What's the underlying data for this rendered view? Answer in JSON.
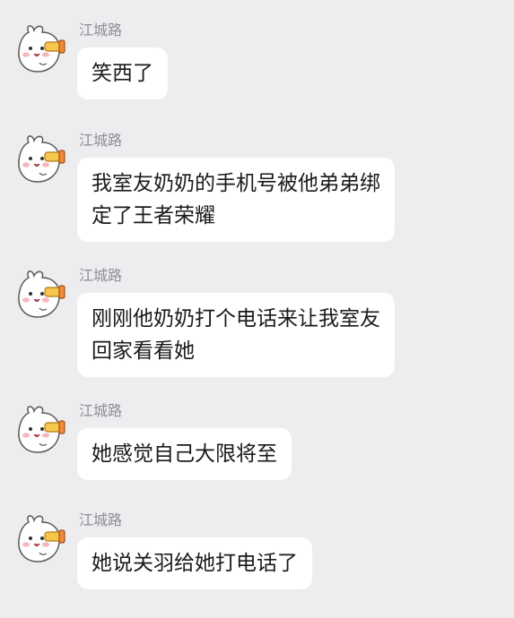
{
  "sender_name": "江城路",
  "avatar_icon": "white-bunny-holding-megaphone-avatar",
  "colors": {
    "background": "#ededf0",
    "bubble": "#ffffff",
    "text": "#1a1a1a",
    "sender": "#8e8e93"
  },
  "messages": [
    {
      "sender": "江城路",
      "lines": [
        "笑西了"
      ]
    },
    {
      "sender": "江城路",
      "lines": [
        "我室友奶奶的手机号被他弟弟绑",
        "定了王者荣耀"
      ]
    },
    {
      "sender": "江城路",
      "lines": [
        "刚刚他奶奶打个电话来让我室友",
        "回家看看她"
      ]
    },
    {
      "sender": "江城路",
      "lines": [
        "她感觉自己大限将至"
      ]
    },
    {
      "sender": "江城路",
      "lines": [
        "她说关羽给她打电话了"
      ]
    }
  ]
}
